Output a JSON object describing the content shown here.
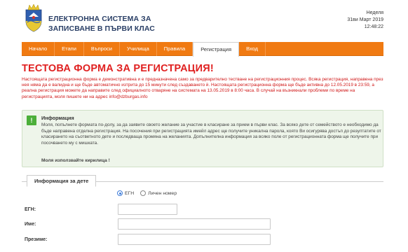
{
  "header": {
    "title_line1": "ЕЛЕКТРОННА СИСТЕМА ЗА",
    "title_line2": "ЗАПИСВАНЕ В ПЪРВИ КЛАС",
    "day": "Неделя",
    "date": "31ви Март 2019",
    "time": "12:48:22"
  },
  "nav": {
    "items": [
      {
        "label": "Начало"
      },
      {
        "label": "Етапи"
      },
      {
        "label": "Въпроси"
      },
      {
        "label": "Училища"
      },
      {
        "label": "Правила"
      },
      {
        "label": "Регистрация"
      },
      {
        "label": "Вход"
      }
    ],
    "active": "Регистрация"
  },
  "main": {
    "heading": "ТЕСТОВА ФОРМА ЗА РЕГИСТРАЦИЯ!",
    "warning": "Настоящата регистрационна форма е демонстративна и е предназначена само за предварително тестване на регистрационния процес. Всяка регистрация, направена през нея няма да е валидна и ще бъде автоматично изтрита до 15 минути след създаването ѝ. Настоящата регистрационна форма ще бъде активна до 12.05.2019 в 23:59, а реална регистрация можете да направите след официалното отваряне на системата на 13.05.2019 в 8:00 часа. В случай на възникнали проблеми по време на регистрацията, моля пишете ни на адрес info@dzburgas.info",
    "info": {
      "icon": "exclamation-icon",
      "title": "Информация",
      "text": "Моля, попълнете формата по-долу, за да заявите своето желание за участие в класиране за прием в първи клас. За всяко дете от семейството е необходимо да бъде направена отделна регистрация. На посочения при регистрацията имейл адрес ще получите уникална парола, която Ви осигурява достъп до резултатите от класирането на съответното дете и последваща промяна на желанията. Допълнителна информация за всяко поле от регистрационната форма ще получите при посочването му с мишката.",
      "note": "Моля използвайте кирилица !"
    },
    "tab_label": "Информация за дете",
    "id_options": [
      "ЕГН",
      "Личен номер"
    ],
    "id_selected": "ЕГН",
    "fields": {
      "egn_label": "ЕГН:",
      "name_label": "Име:",
      "surname_label": "Презиме:"
    }
  },
  "colors": {
    "nav_orange": "#f07a12",
    "heading_red": "#e02020",
    "info_green": "#4caf3a",
    "title_blue": "#2a3f66"
  }
}
